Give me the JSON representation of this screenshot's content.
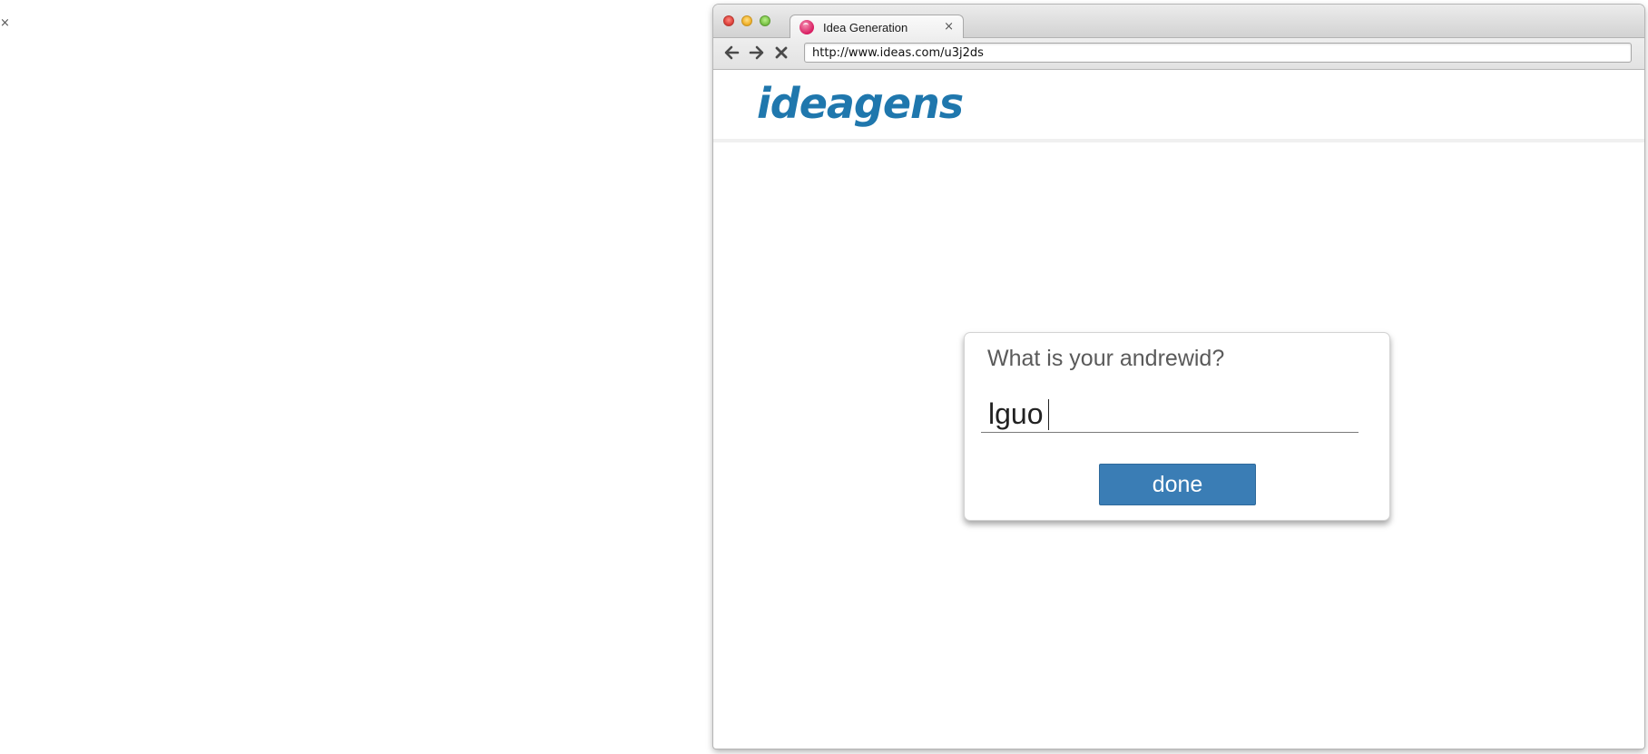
{
  "page": {
    "close_glyph": "×"
  },
  "browser": {
    "tab": {
      "title": "Idea Generation",
      "close_glyph": "×",
      "favicon": "pink-globe-favicon"
    },
    "nav": {
      "back_icon": "arrow-left-icon",
      "forward_icon": "arrow-right-icon",
      "stop_icon": "stop-x-icon"
    },
    "url": "http://www.ideas.com/u3j2ds"
  },
  "site": {
    "logo_text": "ideagens",
    "logo_color": "#1f77ad"
  },
  "dialog": {
    "prompt": "What is your andrewid?",
    "input_value": "lguo",
    "done_label": "done",
    "button_color": "#3a7db5"
  }
}
